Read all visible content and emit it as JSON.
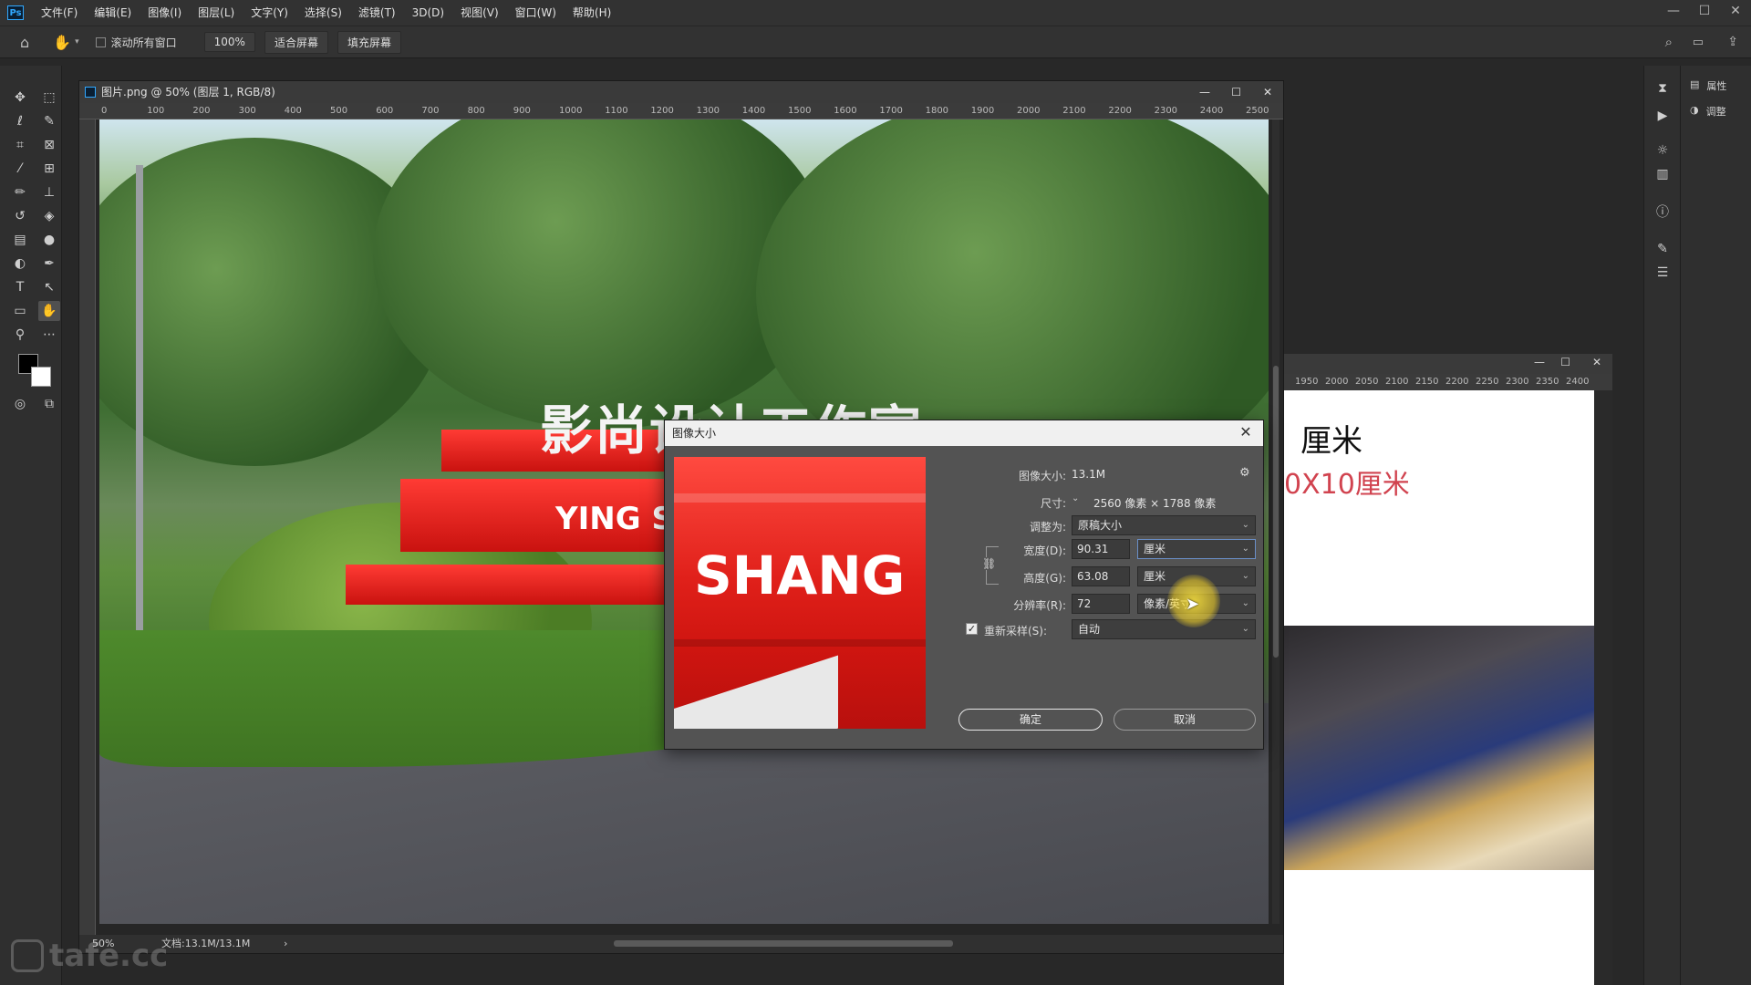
{
  "app": {
    "logo": "Ps",
    "menu": [
      "文件(F)",
      "编辑(E)",
      "图像(I)",
      "图层(L)",
      "文字(Y)",
      "选择(S)",
      "滤镜(T)",
      "3D(D)",
      "视图(V)",
      "窗口(W)",
      "帮助(H)"
    ]
  },
  "options": {
    "scroll_all_label": "滚动所有窗口",
    "zoom_btn": "100%",
    "fit_btn": "适合屏幕",
    "fill_btn": "填充屏幕"
  },
  "document": {
    "title": "图片.png @ 50% (图层 1, RGB/8)",
    "ruler_ticks": [
      "0",
      "100",
      "200",
      "300",
      "400",
      "500",
      "600",
      "700",
      "800",
      "900",
      "1000",
      "1100",
      "1200",
      "1300",
      "1400",
      "1500",
      "1600",
      "1700",
      "1800",
      "1900",
      "2000",
      "2100",
      "2200",
      "2300",
      "2400",
      "2500"
    ],
    "canvas_heading": "影尚设计工作室",
    "sign_text": "YING SH",
    "status_zoom": "50%",
    "status_doc": "文档:13.1M/13.1M"
  },
  "document2": {
    "ruler_ticks": [
      "1950",
      "2000",
      "2050",
      "2100",
      "2150",
      "2200",
      "2250",
      "2300",
      "2350",
      "2400"
    ],
    "text_cm": "厘米",
    "text_size": "0X10厘米"
  },
  "right_panel": {
    "properties": "属性",
    "adjustments": "调整"
  },
  "dialog": {
    "title": "图像大小",
    "preview_text": "SHANG I",
    "image_size_label": "图像大小:",
    "image_size_value": "13.1M",
    "dimensions_label": "尺寸:",
    "dimensions_value": "2560 像素 × 1788 像素",
    "fit_label": "调整为:",
    "fit_value": "原稿大小",
    "width_label": "宽度(D):",
    "width_value": "90.31",
    "width_unit": "厘米",
    "height_label": "高度(G):",
    "height_value": "63.08",
    "height_unit": "厘米",
    "resolution_label": "分辨率(R):",
    "resolution_value": "72",
    "resolution_unit": "像素/英寸",
    "resample_label": "重新采样(S):",
    "resample_value": "自动",
    "ok": "确定",
    "cancel": "取消"
  },
  "watermark": "tafe.cc"
}
